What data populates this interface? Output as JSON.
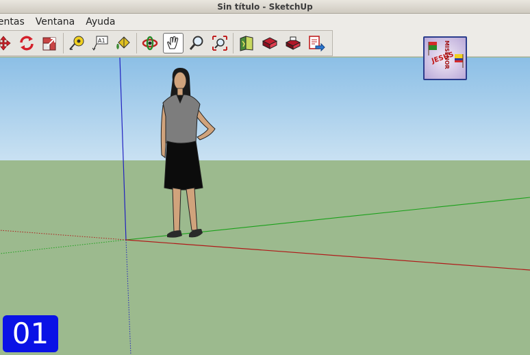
{
  "window": {
    "title": "Sin título - SketchUp"
  },
  "menu": [
    {
      "label": "ientas"
    },
    {
      "label": "Ventana"
    },
    {
      "label": "Ayuda"
    }
  ],
  "toolbar": {
    "buttons": [
      {
        "icon": "move-icon"
      },
      {
        "icon": "rotate-icon"
      },
      {
        "icon": "scale-icon"
      },
      {
        "icon": "tape-measure-icon"
      },
      {
        "icon": "text-label-icon",
        "label": "A1"
      },
      {
        "icon": "paint-bucket-icon"
      },
      {
        "icon": "orbit-icon"
      },
      {
        "icon": "pan-icon",
        "active": true
      },
      {
        "icon": "zoom-icon"
      },
      {
        "icon": "zoom-extents-icon"
      },
      {
        "icon": "get-models-icon"
      },
      {
        "icon": "share-model-icon"
      },
      {
        "icon": "share-component-icon"
      },
      {
        "icon": "send-to-layout-icon"
      }
    ]
  },
  "logo": {
    "text_vertical": "MISENOR",
    "text_horizontal": "JESUS"
  },
  "scene_label": "01",
  "colors": {
    "sky_top": "#8cbfe6",
    "sky_bottom": "#c9e1f2",
    "ground": "#9cba8e",
    "axis_red": "#b01818",
    "axis_green": "#19a019",
    "axis_blue": "#2020c0",
    "scene_badge": "#0a12e6"
  }
}
